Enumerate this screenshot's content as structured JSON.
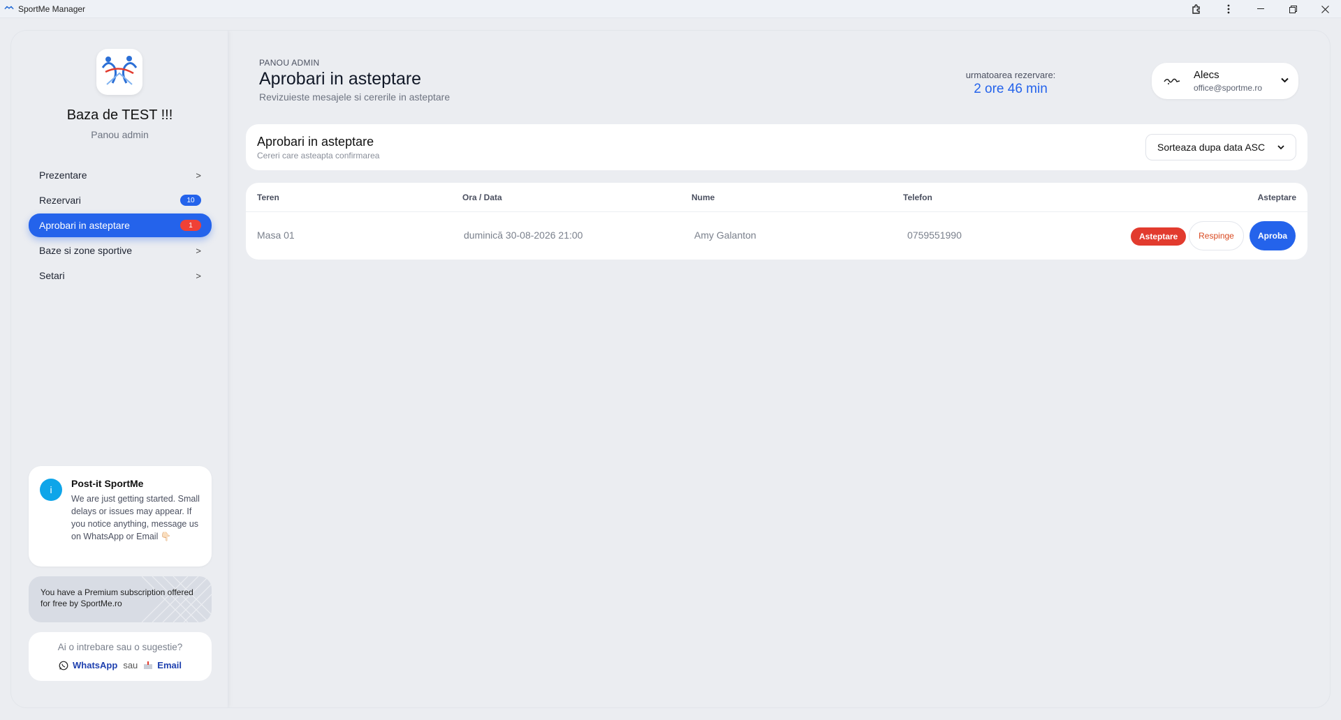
{
  "window": {
    "title": "SportMe Manager",
    "controls": [
      "extensions-icon",
      "more-icon",
      "minimize-icon",
      "restore-icon",
      "close-icon"
    ]
  },
  "sidebar": {
    "org_name": "Baza de TEST !!!",
    "org_sub": "Panou admin",
    "items": [
      {
        "label": "Prezentare",
        "chevron": ">"
      },
      {
        "label": "Rezervari",
        "badge": "10"
      },
      {
        "label": "Aprobari in asteptare",
        "badge": "1",
        "active": true
      },
      {
        "label": "Baze si zone sportive",
        "chevron": ">"
      },
      {
        "label": "Setari",
        "chevron": ">"
      }
    ],
    "postit": {
      "title": "Post-it SportMe",
      "body": "We are just getting started. Small delays or issues may appear. If you notice anything, message us on WhatsApp or Email 👇🏻"
    },
    "premium": "You have a Premium subscription offered for free by SportMe.ro",
    "contact": {
      "question": "Ai o intrebare sau o sugestie?",
      "whatsapp": "WhatsApp",
      "or": "sau",
      "email": "Email"
    }
  },
  "header": {
    "eyebrow": "PANOU ADMIN",
    "title": "Aprobari in asteptare",
    "subtitle": "Revizuieste mesajele si cererile in asteptare",
    "next_label": "urmatoarea rezervare:",
    "next_value": "2 ore 46 min",
    "user_name": "Alecs",
    "user_email": "office@sportme.ro"
  },
  "panel": {
    "title": "Aprobari in asteptare",
    "subtitle": "Cereri care asteapta confirmarea",
    "sort_label": "Sorteaza dupa data ASC"
  },
  "table": {
    "headers": {
      "court": "Teren",
      "datetime": "Ora / Data",
      "name": "Nume",
      "phone": "Telefon",
      "status": "Asteptare"
    },
    "rows": [
      {
        "court": "Masa 01",
        "datetime": "duminică 30-08-2026 21:00",
        "name": "Amy Galanton",
        "phone": "0759551990",
        "status": "Asteptare",
        "reject": "Respinge",
        "approve": "Aproba"
      }
    ]
  },
  "colors": {
    "accent": "#2463eb",
    "danger": "#e23b2e",
    "info": "#0ea5e9"
  }
}
